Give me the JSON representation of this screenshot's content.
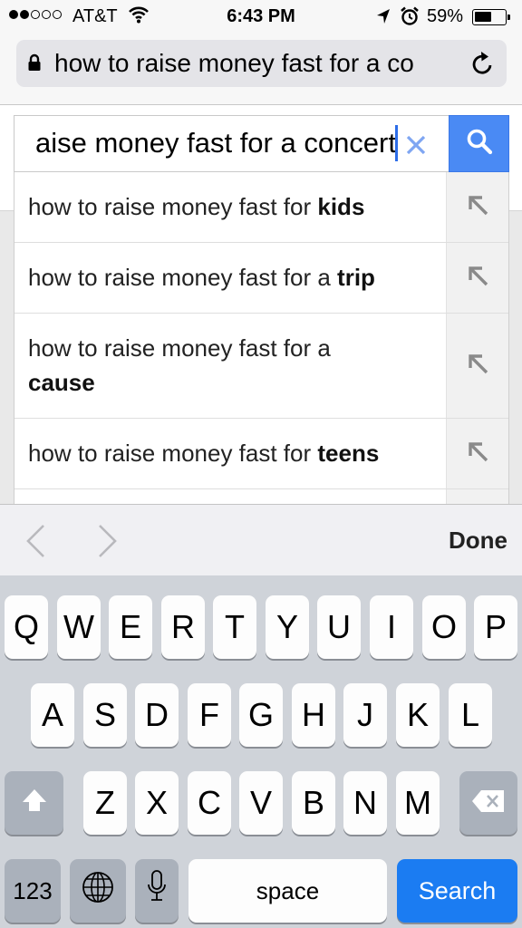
{
  "status_bar": {
    "carrier": "AT&T",
    "time": "6:43 PM",
    "battery": "59%",
    "battery_level": 0.59,
    "signal_bars_filled": 2,
    "signal_bars_total": 5,
    "icons": [
      "signal-dots",
      "wifi-icon",
      "location-arrow-icon",
      "alarm-clock-icon",
      "battery-icon"
    ]
  },
  "url_bar": {
    "text": "how to raise money fast for a co",
    "icons": [
      "lock-icon",
      "reload-icon"
    ]
  },
  "search": {
    "value": "aise money fast for a concert",
    "icons": [
      "clear-x-icon",
      "search-magnifier-icon"
    ],
    "button_color": "#4a8af4"
  },
  "suggestions": [
    {
      "prefix": "how to raise money fast for ",
      "bold": "kids"
    },
    {
      "prefix": "how to raise money fast for a ",
      "bold": "trip"
    },
    {
      "prefix": "how to raise money fast for a ",
      "bold": "cause"
    },
    {
      "prefix": "how to raise money fast for ",
      "bold": "teens"
    }
  ],
  "accessory": {
    "done_label": "Done",
    "icons": [
      "chevron-left-icon",
      "chevron-right-icon"
    ]
  },
  "keyboard": {
    "row1": [
      "Q",
      "W",
      "E",
      "R",
      "T",
      "Y",
      "U",
      "I",
      "O",
      "P"
    ],
    "row2": [
      "A",
      "S",
      "D",
      "F",
      "G",
      "H",
      "J",
      "K",
      "L"
    ],
    "row3": [
      "Z",
      "X",
      "C",
      "V",
      "B",
      "N",
      "M"
    ],
    "numbers_label": "123",
    "space_label": "space",
    "search_label": "Search",
    "icons": [
      "shift-arrow-icon",
      "backspace-icon",
      "globe-icon",
      "microphone-icon"
    ],
    "search_key_color": "#1b7cf2"
  }
}
